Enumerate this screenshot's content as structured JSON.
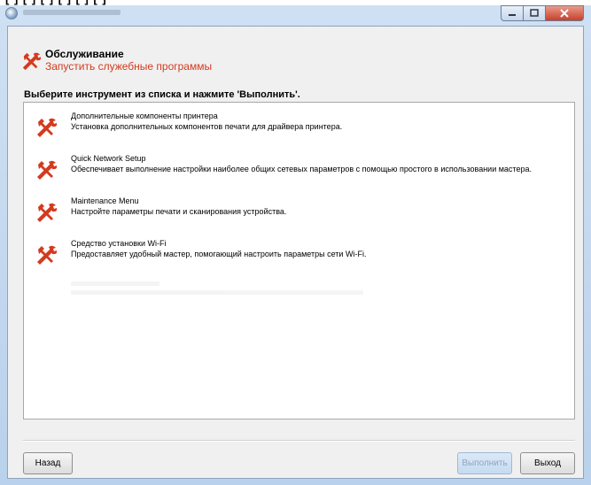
{
  "page_header": {
    "title": "Обслуживание",
    "subtitle": "Запустить служебные программы",
    "icon": "tools-icon"
  },
  "instruction": "Выберите инструмент из списка и нажмите 'Выполнить'.",
  "tools": [
    {
      "name": "Дополнительные компоненты принтера",
      "description": "Установка дополнительных компонентов печати для драйвера принтера.",
      "icon": "tools-icon"
    },
    {
      "name": "Quick Network Setup",
      "description": "Обеспечивает выполнение настройки наиболее общих сетевых параметров с помощью простого в использовании мастера.",
      "icon": "tools-icon"
    },
    {
      "name": "Maintenance Menu",
      "description": "Настройте параметры печати и сканирования устройства.",
      "icon": "tools-icon"
    },
    {
      "name": "Средство установки Wi-Fi",
      "description": "Предоставляет удобный мастер, помогающий настроить параметры сети Wi-Fi.",
      "icon": "tools-icon"
    }
  ],
  "buttons": {
    "back": "Назад",
    "run": "Выполнить",
    "exit": "Выход"
  },
  "window_controls": {
    "minimize": "minimize-icon",
    "maximize": "maximize-icon",
    "close": "close-icon"
  },
  "colors": {
    "accent": "#d43a1e",
    "window_frame": "#b9d1ec",
    "client_background": "#f0f0f0"
  }
}
